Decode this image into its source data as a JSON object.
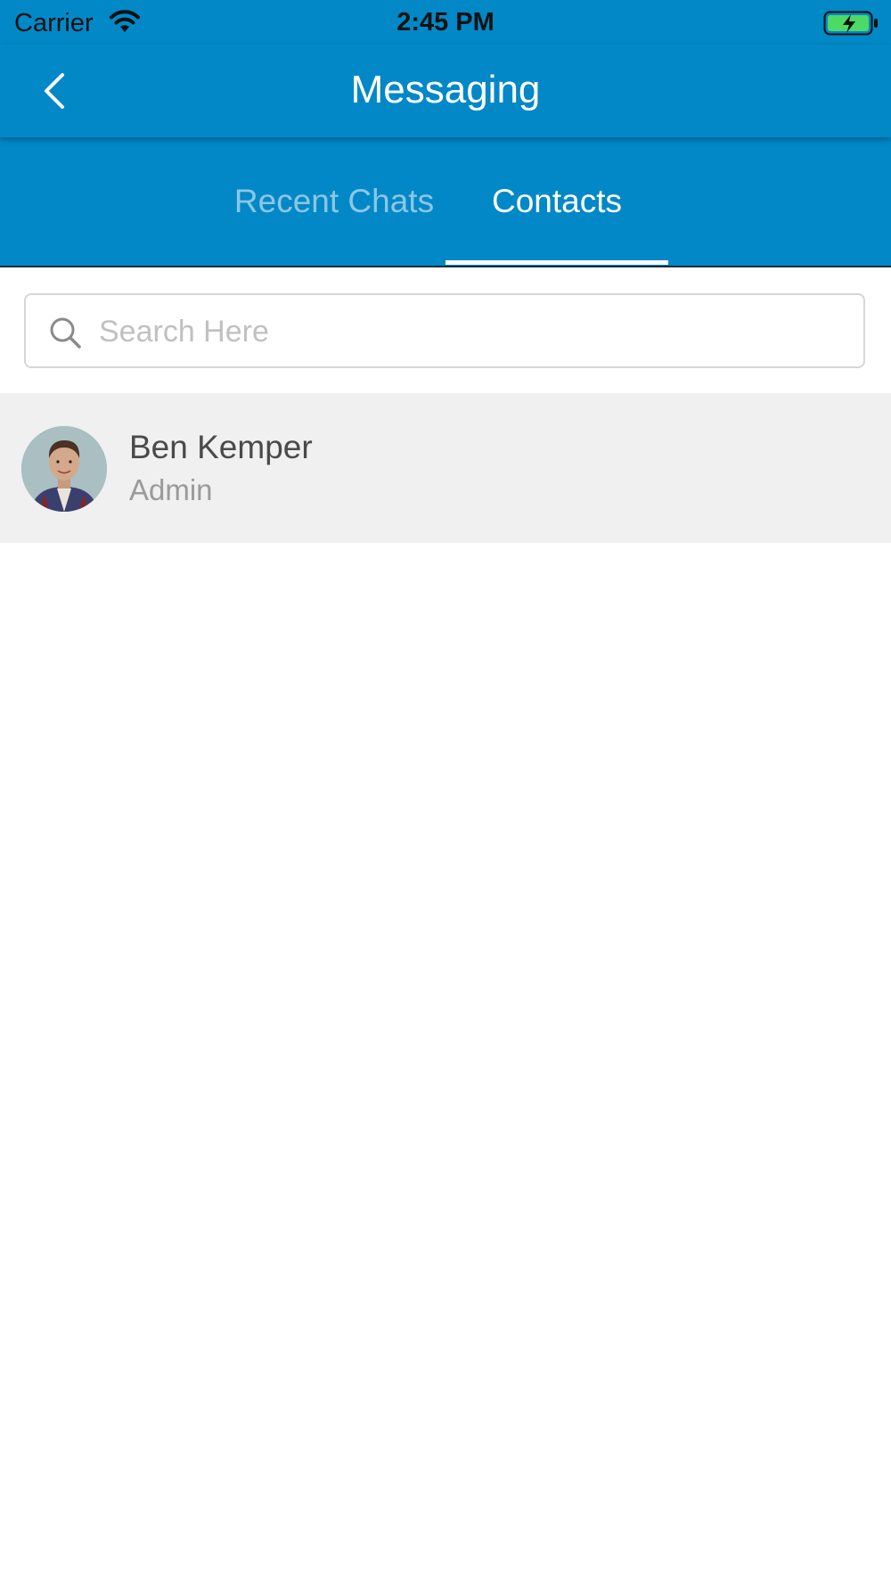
{
  "status_bar": {
    "carrier": "Carrier",
    "time": "2:45 PM",
    "wifi_icon": "wifi-icon",
    "battery_icon": "battery-charging-icon"
  },
  "header": {
    "title": "Messaging",
    "back_icon": "chevron-left-icon"
  },
  "tabs": [
    {
      "label": "Recent Chats",
      "active": false
    },
    {
      "label": "Contacts",
      "active": true
    }
  ],
  "search": {
    "placeholder": "Search Here",
    "value": "",
    "icon": "search-icon"
  },
  "contacts": [
    {
      "name": "Ben Kemper",
      "role": "Admin"
    }
  ],
  "colors": {
    "primary": "#0288c7",
    "tab_inactive": "#8cc6e6",
    "row_background": "#f0f0f0",
    "battery_green": "#4cd964"
  }
}
